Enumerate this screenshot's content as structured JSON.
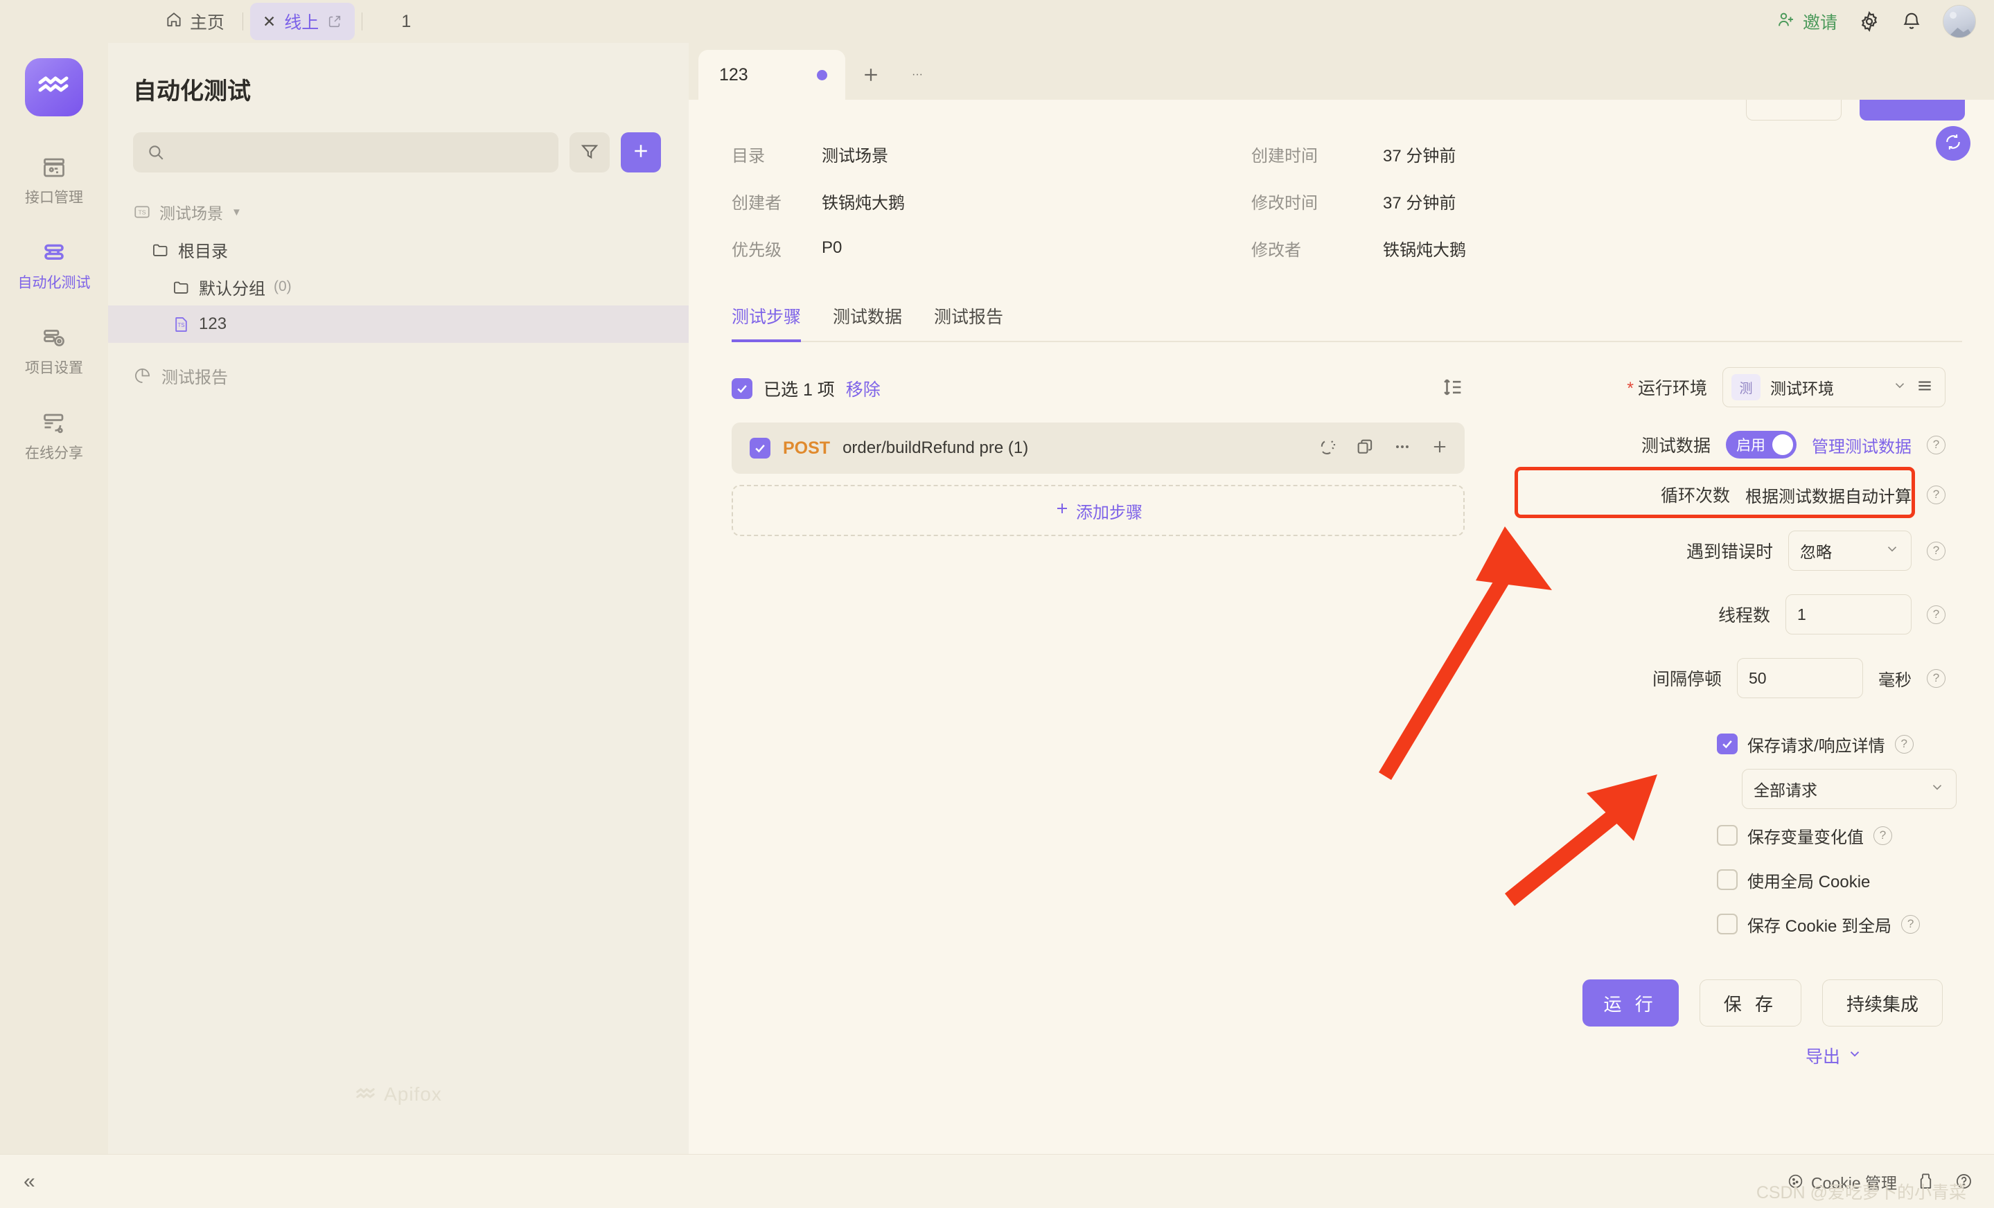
{
  "topbar": {
    "home_label": "主页",
    "tab_label": "线上",
    "tab_close": "✕",
    "counter": "1",
    "invite_label": "邀请",
    "icons": [
      "user-plus-icon",
      "gear-icon",
      "bell-icon",
      "avatar"
    ]
  },
  "rail": {
    "items": [
      {
        "label": "接口管理",
        "icon": "api-box-icon",
        "active": false
      },
      {
        "label": "自动化测试",
        "icon": "automation-icon",
        "active": true
      },
      {
        "label": "项目设置",
        "icon": "project-settings-icon",
        "active": false
      },
      {
        "label": "在线分享",
        "icon": "share-icon",
        "active": false
      }
    ]
  },
  "sidebar": {
    "title": "自动化测试",
    "search_placeholder": "",
    "search_value": "",
    "filter_icon": "filter-icon",
    "add_icon": "plus-icon",
    "group_label": "测试场景",
    "tree": [
      {
        "label": "根目录",
        "icon": "folder-icon",
        "level": 1,
        "selected": false,
        "count": ""
      },
      {
        "label": "默认分组",
        "icon": "folder-icon",
        "level": 2,
        "selected": false,
        "count": "(0)"
      },
      {
        "label": "123",
        "icon": "ts-file-icon",
        "level": 2,
        "selected": true,
        "count": ""
      }
    ],
    "report_label": "测试报告",
    "watermark": "Apifox"
  },
  "main": {
    "doc_tab": "123",
    "tab_plus": "+",
    "tab_more": "···",
    "fab_icon": "sync-icon",
    "meta": [
      {
        "key": "目录",
        "value": "测试场景",
        "key2": "创建时间",
        "value2": "37 分钟前"
      },
      {
        "key": "创建者",
        "value": "铁锅炖大鹅",
        "key2": "修改时间",
        "value2": "37 分钟前"
      },
      {
        "key": "优先级",
        "value": "P0",
        "key2": "修改者",
        "value2": "铁锅炖大鹅"
      }
    ],
    "inner_tabs": [
      {
        "label": "测试步骤",
        "active": true
      },
      {
        "label": "测试数据",
        "active": false
      },
      {
        "label": "测试报告",
        "active": false
      }
    ],
    "steps": {
      "selected_text": "已选 1 项",
      "remove_label": "移除",
      "sort_icon": "sort-icon",
      "rows": [
        {
          "method": "POST",
          "name": "order/buildRefund pre (1)",
          "checked": true,
          "icons": [
            "sync-broken-icon",
            "copy-icon",
            "more-icon",
            "plus-icon"
          ]
        }
      ],
      "add_step_label": "添加步骤"
    },
    "settings": {
      "env_label": "运行环境",
      "env_required": "*",
      "env_badge": "测",
      "env_value": "测试环境",
      "env_menu_icon": "menu-icon",
      "testdata_label": "测试数据",
      "testdata_toggle": "启用",
      "testdata_link": "管理测试数据",
      "loop_label": "循环次数",
      "loop_value": "根据测试数据自动计算",
      "onerror_label": "遇到错误时",
      "onerror_value": "忽略",
      "threads_label": "线程数",
      "threads_value": "1",
      "interval_label": "间隔停顿",
      "interval_value": "50",
      "interval_unit": "毫秒",
      "checkboxes": [
        {
          "label": "保存请求/响应详情",
          "checked": true,
          "help": true
        },
        {
          "label": "保存变量变化值",
          "checked": false,
          "help": true
        },
        {
          "label": "使用全局 Cookie",
          "checked": false,
          "help": false
        },
        {
          "label": "保存 Cookie 到全局",
          "checked": false,
          "help": true
        }
      ],
      "request_scope_value": "全部请求",
      "buttons": [
        {
          "label": "运 行",
          "primary": true
        },
        {
          "label": "保 存",
          "primary": false
        },
        {
          "label": "持续集成",
          "primary": false
        }
      ],
      "export_label": "导出"
    }
  },
  "bottombar": {
    "collapse_icon": "«",
    "cookie_label": "Cookie 管理",
    "icons": [
      "cookie-icon",
      "tools-icon",
      "help-icon"
    ],
    "watermark": "CSDN @爱吃萝卜的小青菜"
  },
  "colors": {
    "accent": "#8670EC",
    "highlight": "#F23B1A",
    "method_post": "#E08A2E",
    "invite_green": "#4C9A5B"
  }
}
